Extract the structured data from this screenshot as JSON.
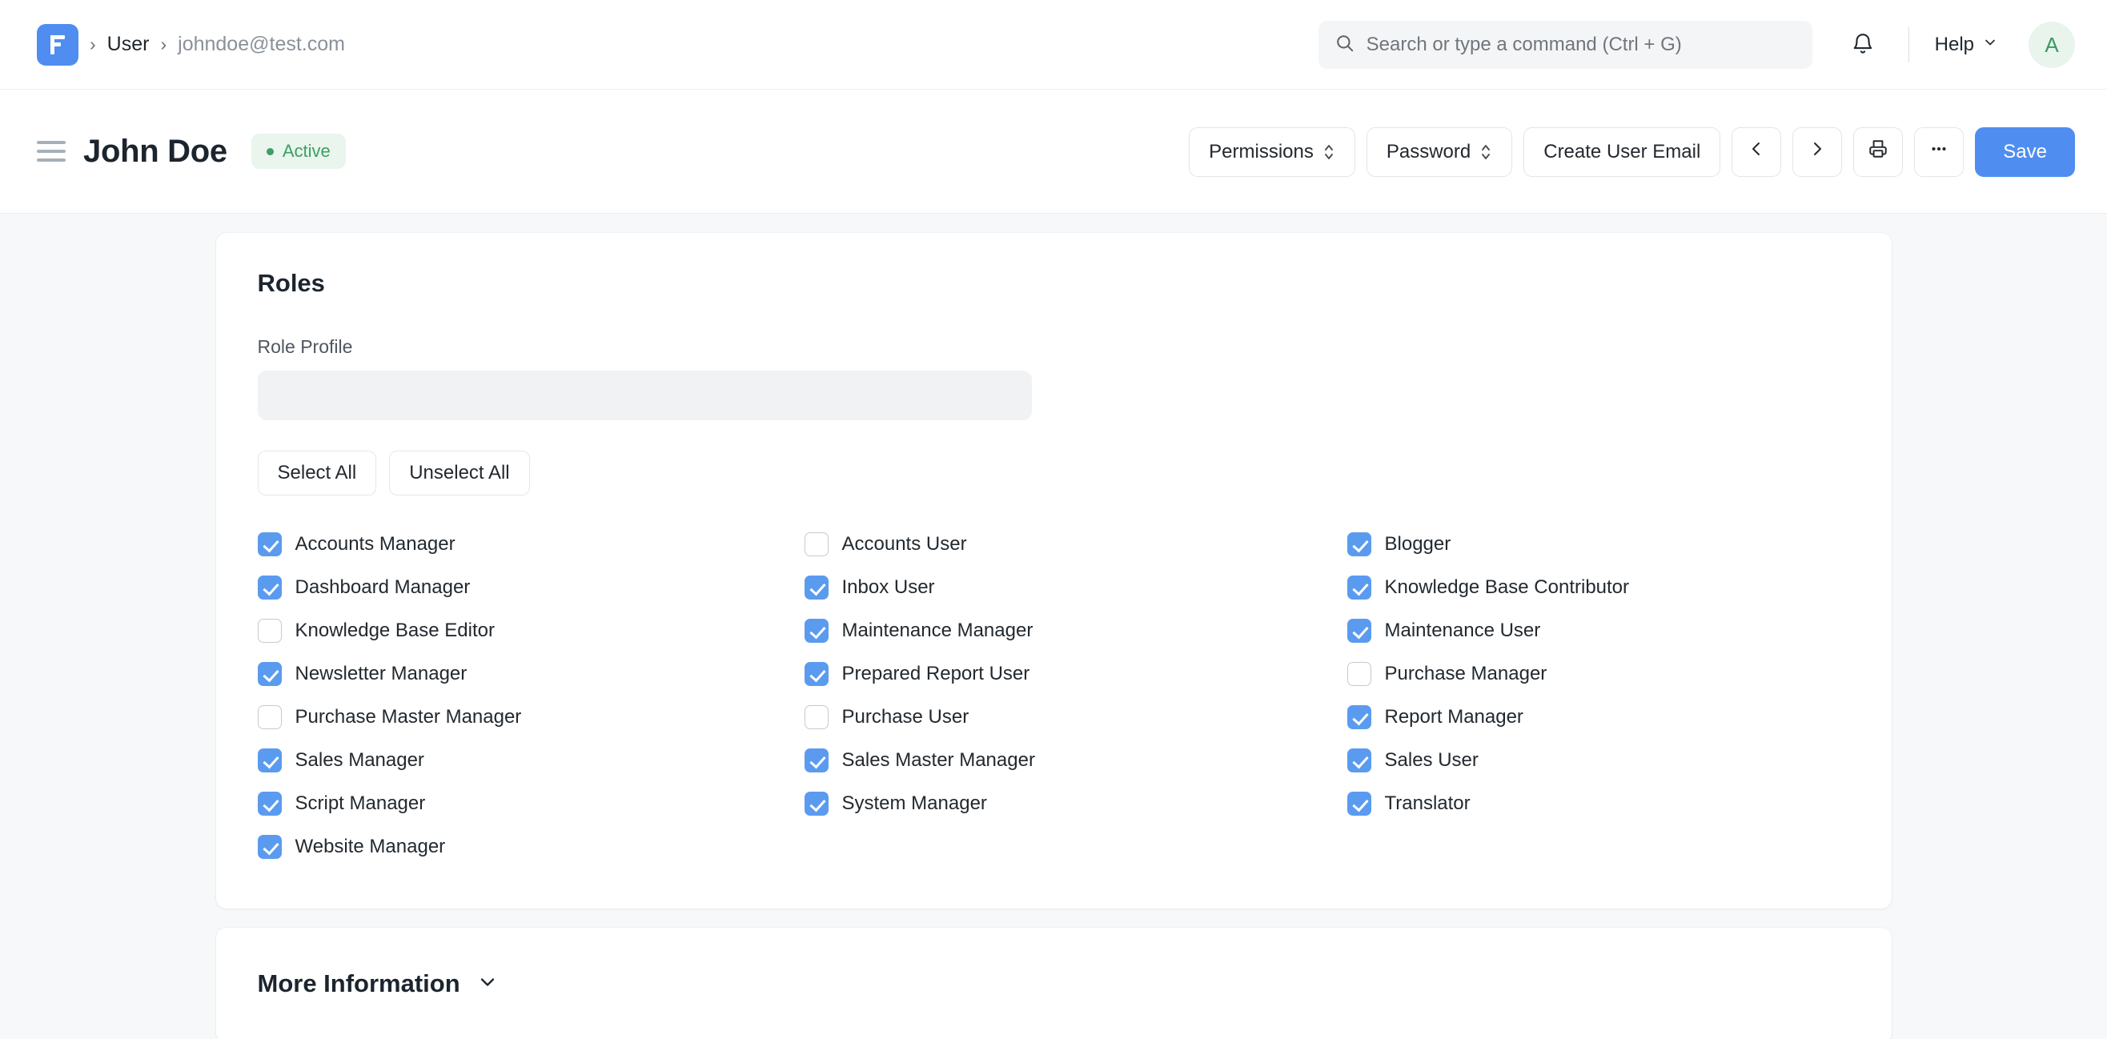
{
  "navbar": {
    "logo_icon": "frappe-logo-icon",
    "breadcrumb": {
      "sep": "›",
      "parent": "User",
      "current": "johndoe@test.com"
    },
    "search": {
      "placeholder": "Search or type a command (Ctrl + G)",
      "value": "",
      "icon": "search-icon"
    },
    "notifications_icon": "bell-icon",
    "help_label": "Help",
    "help_chevron": "chevron-down-icon",
    "avatar_initial": "A"
  },
  "pagehead": {
    "menu_icon": "hamburger-icon",
    "title": "John Doe",
    "status": "Active",
    "actions": {
      "permissions": "Permissions",
      "password": "Password",
      "create_user_email": "Create User Email",
      "prev_icon": "chevron-left-icon",
      "next_icon": "chevron-right-icon",
      "print_icon": "printer-icon",
      "more_icon": "ellipsis-icon",
      "save": "Save"
    }
  },
  "roles_card": {
    "title": "Roles",
    "role_profile": {
      "label": "Role Profile",
      "value": "",
      "placeholder": ""
    },
    "select_all": "Select All",
    "unselect_all": "Unselect All",
    "columns": [
      [
        {
          "label": "Accounts Manager",
          "checked": true
        },
        {
          "label": "Dashboard Manager",
          "checked": true
        },
        {
          "label": "Knowledge Base Editor",
          "checked": false
        },
        {
          "label": "Newsletter Manager",
          "checked": true
        },
        {
          "label": "Purchase Master Manager",
          "checked": false
        },
        {
          "label": "Sales Manager",
          "checked": true
        },
        {
          "label": "Script Manager",
          "checked": true
        },
        {
          "label": "Website Manager",
          "checked": true
        }
      ],
      [
        {
          "label": "Accounts User",
          "checked": false
        },
        {
          "label": "Inbox User",
          "checked": true
        },
        {
          "label": "Maintenance Manager",
          "checked": true
        },
        {
          "label": "Prepared Report User",
          "checked": true
        },
        {
          "label": "Purchase User",
          "checked": false
        },
        {
          "label": "Sales Master Manager",
          "checked": true
        },
        {
          "label": "System Manager",
          "checked": true
        }
      ],
      [
        {
          "label": "Blogger",
          "checked": true
        },
        {
          "label": "Knowledge Base Contributor",
          "checked": true
        },
        {
          "label": "Maintenance User",
          "checked": true
        },
        {
          "label": "Purchase Manager",
          "checked": false
        },
        {
          "label": "Report Manager",
          "checked": true
        },
        {
          "label": "Sales User",
          "checked": true
        },
        {
          "label": "Translator",
          "checked": true
        }
      ]
    ]
  },
  "more_information": {
    "title": "More Information",
    "chevron": "chevron-down-icon"
  },
  "colors": {
    "brand_blue": "#4f8ef0",
    "checkbox_blue": "#5a9bf0",
    "status_green": "#3e9e63",
    "status_green_bg": "#e9f5ed",
    "page_bg": "#f7f8f9",
    "card_bg": "#ffffff",
    "input_bg": "#f1f2f4"
  }
}
